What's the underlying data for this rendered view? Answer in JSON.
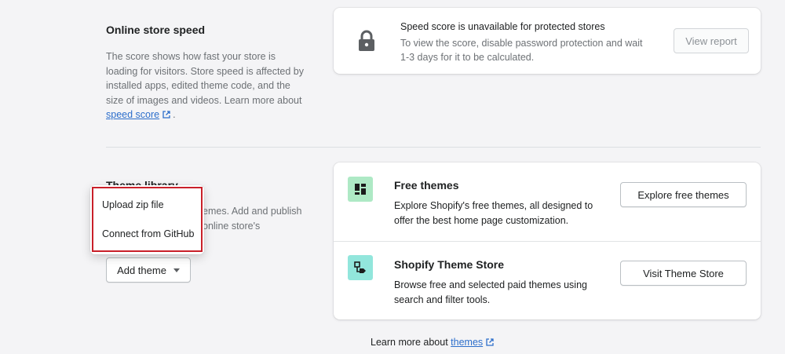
{
  "speed": {
    "title": "Online store speed",
    "description_line1": "The score shows how fast your store is",
    "description_line2": "loading for visitors. Store speed is affected by",
    "description_line3": "installed apps, edited theme code, and the",
    "description_line4": "size of images and videos. Learn more about",
    "link_text": "speed score",
    "trailing": ".",
    "card": {
      "icon": "lock-icon",
      "heading": "Speed score is unavailable for protected stores",
      "text_line1": "To view the score, disable password protection and wait",
      "text_line2": "1-3 days for it to be calculated.",
      "button_label": "View report"
    }
  },
  "theme_library": {
    "title_partial": "Theme library",
    "desc_line1_partial": "emes. Add and publish",
    "desc_line2_partial": "online store's",
    "add_theme_label": "Add theme",
    "dropdown": {
      "items": [
        "Upload zip file",
        "Connect from GitHub"
      ]
    }
  },
  "themes_card": {
    "rows": [
      {
        "icon": "layout-icon",
        "title": "Free themes",
        "desc_line1": "Explore Shopify's free themes, all designed to",
        "desc_line2": "offer the best home page customization.",
        "button_label": "Explore free themes"
      },
      {
        "icon": "store-tag-icon",
        "title": "Shopify Theme Store",
        "desc_line1": "Browse free and selected paid themes using",
        "desc_line2": "search and filter tools.",
        "button_label": "Visit Theme Store"
      }
    ]
  },
  "footer": {
    "prefix": "Learn more about ",
    "link_text": "themes"
  },
  "colors": {
    "background": "#f4f4f6",
    "link": "#2c6ecb",
    "icon_green": "#aee9c5",
    "icon_teal": "#92e6dc",
    "highlight_red": "#c9202a"
  }
}
